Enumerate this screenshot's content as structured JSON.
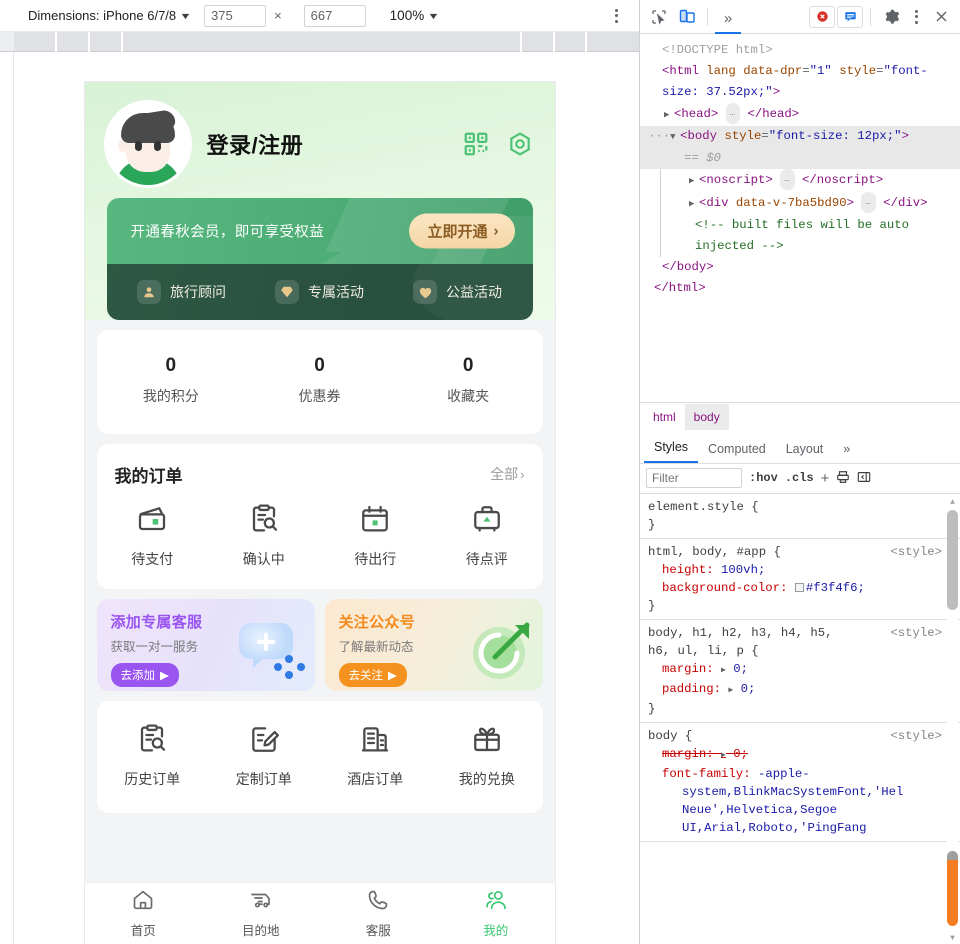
{
  "device_toolbar": {
    "dimensions_label": "Dimensions: iPhone 6/7/8",
    "width_value": "375",
    "height_value": "667",
    "multiply": "×",
    "zoom_label": "100%",
    "caret": "▼",
    "menu_icon": "kebab-menu-icon"
  },
  "mobile": {
    "header": {
      "login_text": "登录/注册",
      "qr_icon": "qr-code-icon",
      "settings_icon": "hexagon-settings-icon"
    },
    "member_banner": {
      "text": "开通春秋会员，即可享受权益",
      "button": "立即开通",
      "chevron": "›"
    },
    "benefits": [
      {
        "label": "旅行顾问",
        "icon": "advisor-icon"
      },
      {
        "label": "专属活动",
        "icon": "diamond-icon"
      },
      {
        "label": "公益活动",
        "icon": "heart-icon"
      }
    ],
    "stats": [
      {
        "value": "0",
        "label": "我的积分"
      },
      {
        "value": "0",
        "label": "优惠券"
      },
      {
        "value": "0",
        "label": "收藏夹"
      }
    ],
    "orders": {
      "title": "我的订单",
      "all_label": "全部",
      "chevron": "›",
      "items": [
        {
          "label": "待支付",
          "icon": "wallet-icon"
        },
        {
          "label": "确认中",
          "icon": "clipboard-search-icon"
        },
        {
          "label": "待出行",
          "icon": "calendar-icon"
        },
        {
          "label": "待点评",
          "icon": "suitcase-icon"
        }
      ]
    },
    "promos": [
      {
        "title": "添加专属客服",
        "subtitle": "获取一对一服务",
        "button": "去添加",
        "arrow": "▶",
        "art_icon": "chat-bubble-plus-icon",
        "color": "#9a55f0"
      },
      {
        "title": "关注公众号",
        "subtitle": "了解最新动态",
        "button": "去关注",
        "arrow": "▶",
        "art_icon": "target-arrow-icon",
        "color": "#f5911f"
      }
    ],
    "tools": [
      {
        "label": "历史订单",
        "icon": "clipboard-search-icon"
      },
      {
        "label": "定制订单",
        "icon": "edit-note-icon"
      },
      {
        "label": "酒店订单",
        "icon": "hotel-building-icon"
      },
      {
        "label": "我的兑换",
        "icon": "gift-icon"
      }
    ],
    "tabbar": [
      {
        "label": "首页",
        "icon": "home-icon",
        "active": false
      },
      {
        "label": "目的地",
        "icon": "truck-icon",
        "active": false
      },
      {
        "label": "客服",
        "icon": "phone-icon",
        "active": false
      },
      {
        "label": "我的",
        "icon": "user-group-icon",
        "active": true
      }
    ]
  },
  "devtools": {
    "toolbar": {
      "inspect_icon": "inspect-element-icon",
      "device_icon": "toggle-device-toolbar-icon",
      "more_panels": "»",
      "error_count_icon": "error-badge-icon",
      "message_icon": "console-message-icon",
      "settings_icon": "gear-icon",
      "kebab_icon": "kebab-menu-icon",
      "close_icon": "close-icon"
    },
    "dom_lines": [
      {
        "indent": 0,
        "html": "<span class=\"dcty\">&lt;!DOCTYPE html&gt;</span>"
      },
      {
        "indent": 0,
        "html": "<span class=\"tag\">&lt;html</span> <span class=\"attr\">lang</span> <span class=\"attr\">data-dpr</span>=<span class=\"val\">\"1\"</span> <span class=\"attr\">style</span>=<span class=\"val\">\"font-size: 37.52px;\"</span><span class=\"tag\">&gt;</span>"
      }
    ],
    "dom_text": {
      "doctype": "<!DOCTYPE html>",
      "html_open": "<html lang data-dpr=\"1\" style=\"font-size: 37.52px;\">",
      "head": "<head> … </head>",
      "body_open": "<body style=\"font-size: 12px;\">",
      "selected_marker": "== $0",
      "noscript": "<noscript> … </noscript>",
      "div": "<div data-v-7ba5bd90> … </div>",
      "comment": "<!-- built files will be auto injected -->",
      "body_close": "</body>",
      "html_close": "</html>"
    },
    "breadcrumbs": [
      {
        "label": "html",
        "active": false
      },
      {
        "label": "body",
        "active": true
      }
    ],
    "panel_tabs": [
      {
        "label": "Styles",
        "active": true
      },
      {
        "label": "Computed",
        "active": false
      },
      {
        "label": "Layout",
        "active": false
      },
      {
        "label": "»",
        "active": false
      }
    ],
    "styles_bar": {
      "filter_placeholder": "Filter",
      "hov": ":hov",
      "cls": ".cls",
      "plus": "+",
      "print_icon": "print-media-icon",
      "sidebar_icon": "toggle-sidebar-icon"
    },
    "rules": [
      {
        "selector": "element.style {",
        "source": "",
        "declarations": [],
        "close": "}"
      },
      {
        "selector": "html, body, #app {",
        "source": "<style>",
        "declarations": [
          {
            "prop": "height",
            "value": "100vh;",
            "swatch": false,
            "struck": false
          },
          {
            "prop": "background-color",
            "value": "#f3f4f6;",
            "swatch": true,
            "struck": false
          }
        ],
        "close": "}"
      },
      {
        "selector": "body, h1, h2, h3, h4, h5, h6, ul, li, p {",
        "source": "<style>",
        "declarations": [
          {
            "prop": "margin",
            "value": "0;",
            "tri": true,
            "struck": false
          },
          {
            "prop": "padding",
            "value": "0;",
            "tri": true,
            "struck": false
          }
        ],
        "close": "}"
      },
      {
        "selector": "body {",
        "source": "<style>",
        "declarations": [
          {
            "prop": "margin",
            "value": "0;",
            "tri": true,
            "struck": true
          },
          {
            "prop": "font-family",
            "value": "-apple-system,BlinkMacSystemFont,'Hel Neue',Helvetica,Segoe UI,Arial,Roboto,'PingFang",
            "struck": false
          }
        ],
        "close": ""
      }
    ]
  }
}
